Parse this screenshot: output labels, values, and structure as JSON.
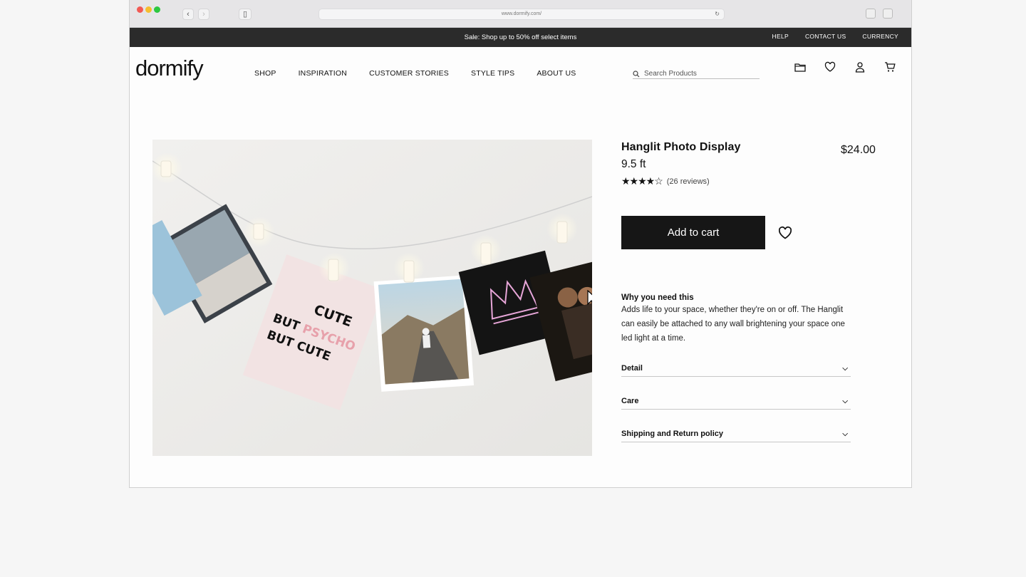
{
  "browser": {
    "url": "www.dormify.com/"
  },
  "promo": {
    "message": "Sale: Shop up to 50% off select items",
    "links": [
      "HELP",
      "CONTACT US",
      "CURRENCY"
    ]
  },
  "header": {
    "logo": "dormify",
    "menu": [
      "SHOP",
      "INSPIRATION",
      "CUSTOMER STORIES",
      "STYLE TIPS",
      "ABOUT US"
    ],
    "search_placeholder": "Search Products",
    "icons": [
      "folder-icon",
      "heart-icon",
      "user-icon",
      "cart-icon"
    ]
  },
  "hero": {
    "card_text": [
      "CUTE",
      "BUT PSYCHO",
      "BUT CUTE"
    ]
  },
  "product": {
    "title": "Hanglit Photo Display",
    "variant": "9.5 ft",
    "price": "$24.00",
    "rating": 4.5,
    "stars": "★★★★☆",
    "reviews": "(26 reviews)",
    "add_to_cart": "Add to cart",
    "why_heading": "Why you need this",
    "why_text": "Adds life to your space, whether they're on or off. The Hanglit can easily be attached to any wall brightening your space one led light at a time.",
    "accordions": [
      "Detail",
      "Care",
      "Shipping and Return policy"
    ]
  },
  "colors": {
    "promo_bg": "#2b2b2b",
    "button_bg": "#161616",
    "accent_pink": "#e7a1ab"
  }
}
